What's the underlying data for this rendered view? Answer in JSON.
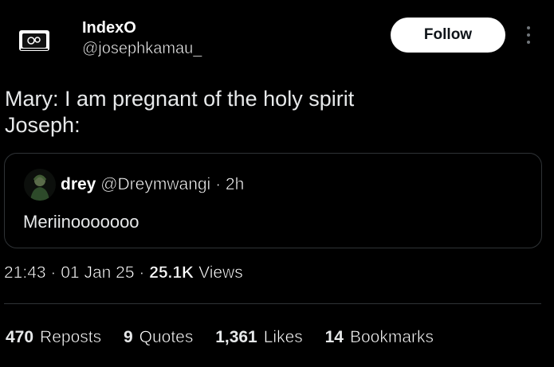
{
  "author": {
    "name": "IndexO",
    "handle": "@josephkamau_"
  },
  "follow_label": "Follow",
  "tweet": {
    "line1": "Mary: I am pregnant of the holy spirit",
    "line2": "Joseph:"
  },
  "quoted": {
    "name": "drey",
    "handle": "@Dreymwangi",
    "time": "2h",
    "text": "Meriinooooooo"
  },
  "meta": {
    "time": "21:43",
    "date": "01 Jan 25",
    "views": "25.1K",
    "views_label": "Views"
  },
  "stats": [
    {
      "num": "470",
      "label": "Reposts"
    },
    {
      "num": "9",
      "label": "Quotes"
    },
    {
      "num": "1,361",
      "label": "Likes"
    },
    {
      "num": "14",
      "label": "Bookmarks"
    }
  ]
}
